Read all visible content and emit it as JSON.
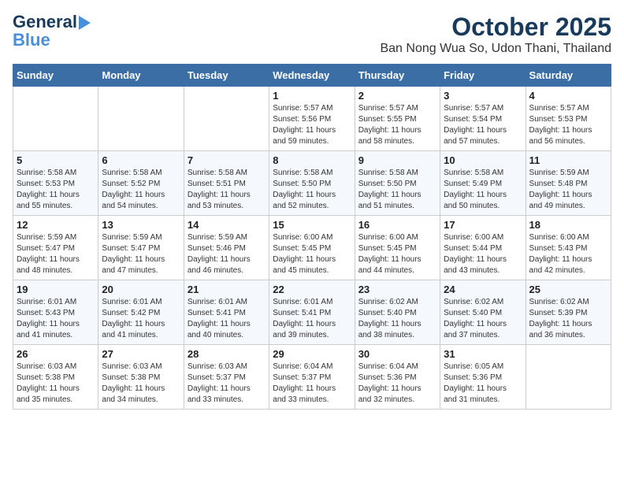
{
  "header": {
    "logo_line1": "General",
    "logo_line2": "Blue",
    "month": "October 2025",
    "location": "Ban Nong Wua So, Udon Thani, Thailand"
  },
  "weekdays": [
    "Sunday",
    "Monday",
    "Tuesday",
    "Wednesday",
    "Thursday",
    "Friday",
    "Saturday"
  ],
  "weeks": [
    [
      {
        "day": "",
        "info": ""
      },
      {
        "day": "",
        "info": ""
      },
      {
        "day": "",
        "info": ""
      },
      {
        "day": "1",
        "info": "Sunrise: 5:57 AM\nSunset: 5:56 PM\nDaylight: 11 hours\nand 59 minutes."
      },
      {
        "day": "2",
        "info": "Sunrise: 5:57 AM\nSunset: 5:55 PM\nDaylight: 11 hours\nand 58 minutes."
      },
      {
        "day": "3",
        "info": "Sunrise: 5:57 AM\nSunset: 5:54 PM\nDaylight: 11 hours\nand 57 minutes."
      },
      {
        "day": "4",
        "info": "Sunrise: 5:57 AM\nSunset: 5:53 PM\nDaylight: 11 hours\nand 56 minutes."
      }
    ],
    [
      {
        "day": "5",
        "info": "Sunrise: 5:58 AM\nSunset: 5:53 PM\nDaylight: 11 hours\nand 55 minutes."
      },
      {
        "day": "6",
        "info": "Sunrise: 5:58 AM\nSunset: 5:52 PM\nDaylight: 11 hours\nand 54 minutes."
      },
      {
        "day": "7",
        "info": "Sunrise: 5:58 AM\nSunset: 5:51 PM\nDaylight: 11 hours\nand 53 minutes."
      },
      {
        "day": "8",
        "info": "Sunrise: 5:58 AM\nSunset: 5:50 PM\nDaylight: 11 hours\nand 52 minutes."
      },
      {
        "day": "9",
        "info": "Sunrise: 5:58 AM\nSunset: 5:50 PM\nDaylight: 11 hours\nand 51 minutes."
      },
      {
        "day": "10",
        "info": "Sunrise: 5:58 AM\nSunset: 5:49 PM\nDaylight: 11 hours\nand 50 minutes."
      },
      {
        "day": "11",
        "info": "Sunrise: 5:59 AM\nSunset: 5:48 PM\nDaylight: 11 hours\nand 49 minutes."
      }
    ],
    [
      {
        "day": "12",
        "info": "Sunrise: 5:59 AM\nSunset: 5:47 PM\nDaylight: 11 hours\nand 48 minutes."
      },
      {
        "day": "13",
        "info": "Sunrise: 5:59 AM\nSunset: 5:47 PM\nDaylight: 11 hours\nand 47 minutes."
      },
      {
        "day": "14",
        "info": "Sunrise: 5:59 AM\nSunset: 5:46 PM\nDaylight: 11 hours\nand 46 minutes."
      },
      {
        "day": "15",
        "info": "Sunrise: 6:00 AM\nSunset: 5:45 PM\nDaylight: 11 hours\nand 45 minutes."
      },
      {
        "day": "16",
        "info": "Sunrise: 6:00 AM\nSunset: 5:45 PM\nDaylight: 11 hours\nand 44 minutes."
      },
      {
        "day": "17",
        "info": "Sunrise: 6:00 AM\nSunset: 5:44 PM\nDaylight: 11 hours\nand 43 minutes."
      },
      {
        "day": "18",
        "info": "Sunrise: 6:00 AM\nSunset: 5:43 PM\nDaylight: 11 hours\nand 42 minutes."
      }
    ],
    [
      {
        "day": "19",
        "info": "Sunrise: 6:01 AM\nSunset: 5:43 PM\nDaylight: 11 hours\nand 41 minutes."
      },
      {
        "day": "20",
        "info": "Sunrise: 6:01 AM\nSunset: 5:42 PM\nDaylight: 11 hours\nand 41 minutes."
      },
      {
        "day": "21",
        "info": "Sunrise: 6:01 AM\nSunset: 5:41 PM\nDaylight: 11 hours\nand 40 minutes."
      },
      {
        "day": "22",
        "info": "Sunrise: 6:01 AM\nSunset: 5:41 PM\nDaylight: 11 hours\nand 39 minutes."
      },
      {
        "day": "23",
        "info": "Sunrise: 6:02 AM\nSunset: 5:40 PM\nDaylight: 11 hours\nand 38 minutes."
      },
      {
        "day": "24",
        "info": "Sunrise: 6:02 AM\nSunset: 5:40 PM\nDaylight: 11 hours\nand 37 minutes."
      },
      {
        "day": "25",
        "info": "Sunrise: 6:02 AM\nSunset: 5:39 PM\nDaylight: 11 hours\nand 36 minutes."
      }
    ],
    [
      {
        "day": "26",
        "info": "Sunrise: 6:03 AM\nSunset: 5:38 PM\nDaylight: 11 hours\nand 35 minutes."
      },
      {
        "day": "27",
        "info": "Sunrise: 6:03 AM\nSunset: 5:38 PM\nDaylight: 11 hours\nand 34 minutes."
      },
      {
        "day": "28",
        "info": "Sunrise: 6:03 AM\nSunset: 5:37 PM\nDaylight: 11 hours\nand 33 minutes."
      },
      {
        "day": "29",
        "info": "Sunrise: 6:04 AM\nSunset: 5:37 PM\nDaylight: 11 hours\nand 33 minutes."
      },
      {
        "day": "30",
        "info": "Sunrise: 6:04 AM\nSunset: 5:36 PM\nDaylight: 11 hours\nand 32 minutes."
      },
      {
        "day": "31",
        "info": "Sunrise: 6:05 AM\nSunset: 5:36 PM\nDaylight: 11 hours\nand 31 minutes."
      },
      {
        "day": "",
        "info": ""
      }
    ]
  ]
}
